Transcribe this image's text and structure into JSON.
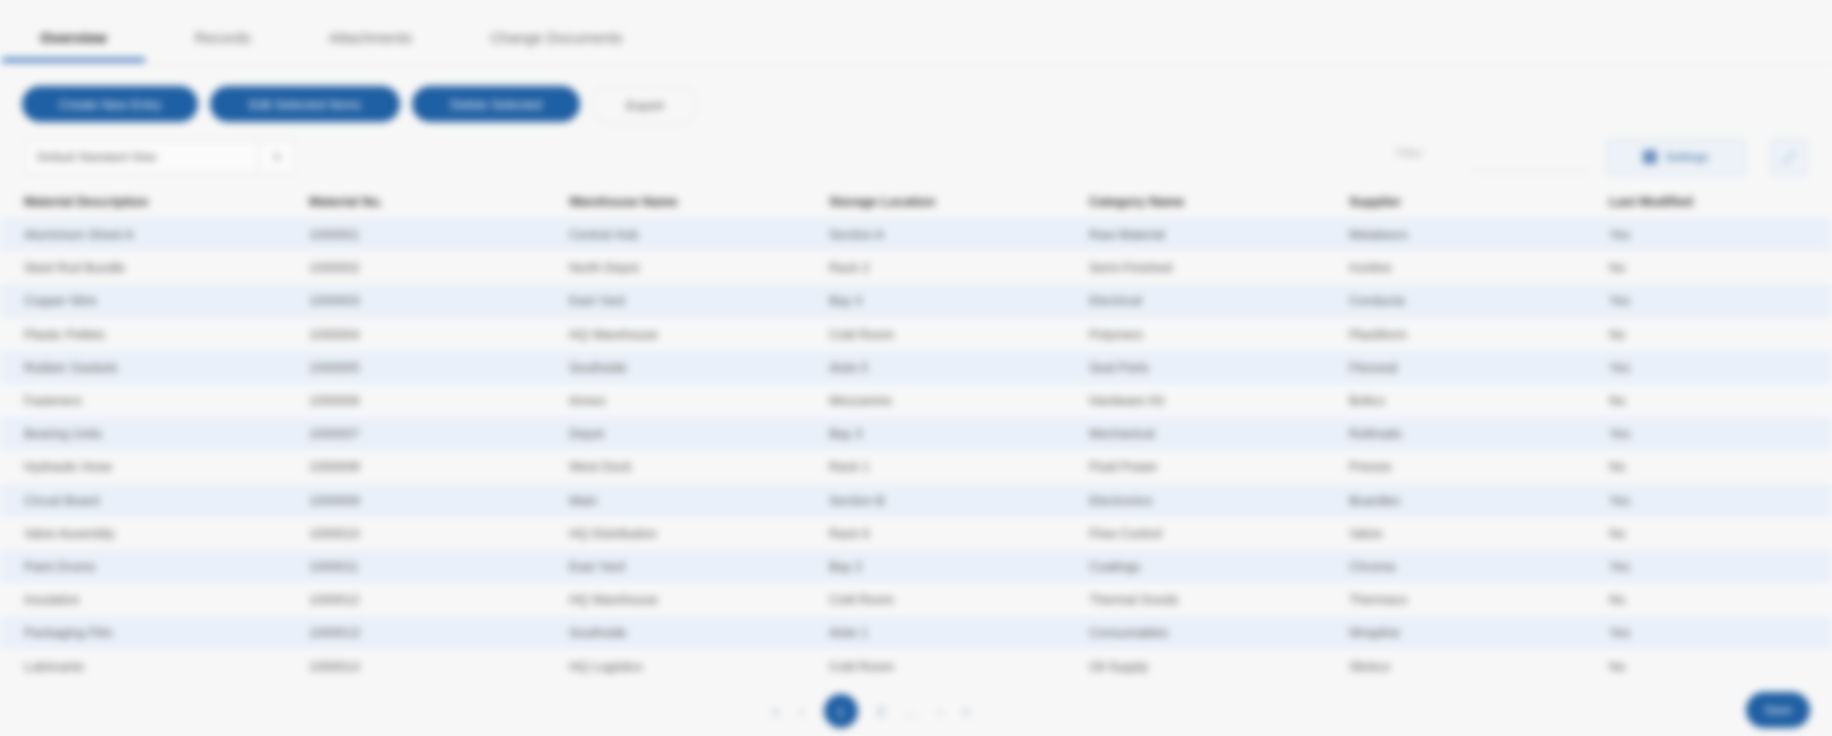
{
  "tabs": [
    "Overview",
    "Records",
    "Attachments",
    "Change Documents"
  ],
  "actions": {
    "primary": [
      "Create New Entry",
      "Edit Selected Items",
      "Delete Selected"
    ],
    "secondary": "Export"
  },
  "toolbar": {
    "dropdown_label": "Default Standard View",
    "filter_label": "Filter",
    "tool_button": "Settings",
    "icon_button": "⤢"
  },
  "table": {
    "columns": [
      "Material Description",
      "Material No.",
      "Warehouse Name",
      "Storage Location",
      "Category Name",
      "Supplier",
      "Last Modified"
    ],
    "rows": [
      [
        "Aluminium Sheet A",
        "1000001",
        "Central Hub",
        "Section A",
        "Raw Material",
        "Metalworx",
        "Yes"
      ],
      [
        "Steel Rod Bundle",
        "1000002",
        "North Depot",
        "Rack 2",
        "Semi-Finished",
        "Ironline",
        "No"
      ],
      [
        "Copper Wire",
        "1000003",
        "East Yard",
        "Bay 4",
        "Electrical",
        "Conducta",
        "Yes"
      ],
      [
        "Plastic Pellets",
        "1000004",
        "HQ Warehouse",
        "Cold Room",
        "Polymers",
        "Plastiform",
        "No"
      ],
      [
        "Rubber Gaskets",
        "1000005",
        "Southside",
        "Aisle 5",
        "Seal Parts",
        "Flexseal",
        "Yes"
      ],
      [
        "Fasteners",
        "1000006",
        "Annex",
        "Mezzanine",
        "Hardware Kit",
        "Boltco",
        "No"
      ],
      [
        "Bearing Units",
        "1000007",
        "Depot",
        "Bay 3",
        "Mechanical",
        "Rollmatic",
        "Yes"
      ],
      [
        "Hydraulic Hose",
        "1000008",
        "West Dock",
        "Rack 1",
        "Fluid Power",
        "Pressix",
        "No"
      ],
      [
        "Circuit Board",
        "1000009",
        "Main",
        "Section B",
        "Electronics",
        "Boardtec",
        "Yes"
      ],
      [
        "Valve Assembly",
        "1000010",
        "HQ Distribution",
        "Rack 6",
        "Flow Control",
        "Valvix",
        "No"
      ],
      [
        "Paint Drums",
        "1000011",
        "East Yard",
        "Bay 2",
        "Coatings",
        "Chroma",
        "Yes"
      ],
      [
        "Insulation",
        "1000012",
        "HQ Warehouse",
        "Cold Room",
        "Thermal Goods",
        "Thermaco",
        "No"
      ],
      [
        "Packaging Film",
        "1000013",
        "Southside",
        "Aisle 1",
        "Consumables",
        "Wrapline",
        "Yes"
      ],
      [
        "Lubricants",
        "1000014",
        "HQ Logistics",
        "Cold Room",
        "Oil Supply",
        "Slickco",
        "No"
      ]
    ]
  },
  "pager": {
    "first": "«",
    "prev": "‹",
    "current": "1",
    "page2": "2",
    "ellipsis": "…",
    "next": "›",
    "last_label": "»",
    "more": "»"
  },
  "footer": {
    "button": "Save"
  },
  "colors": {
    "accent": "#1f5fa3",
    "row_alt": "#e9f0f9",
    "background": "#f7f7f7"
  }
}
